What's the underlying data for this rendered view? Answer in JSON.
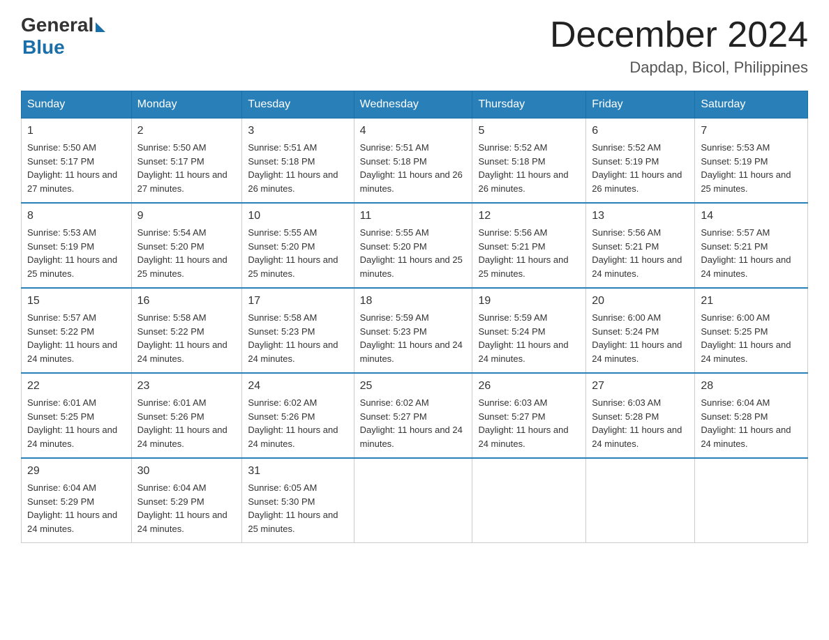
{
  "logo": {
    "general": "General",
    "blue": "Blue"
  },
  "title": "December 2024",
  "subtitle": "Dapdap, Bicol, Philippines",
  "days": [
    "Sunday",
    "Monday",
    "Tuesday",
    "Wednesday",
    "Thursday",
    "Friday",
    "Saturday"
  ],
  "weeks": [
    [
      {
        "day": "1",
        "sunrise": "5:50 AM",
        "sunset": "5:17 PM",
        "daylight": "11 hours and 27 minutes."
      },
      {
        "day": "2",
        "sunrise": "5:50 AM",
        "sunset": "5:17 PM",
        "daylight": "11 hours and 27 minutes."
      },
      {
        "day": "3",
        "sunrise": "5:51 AM",
        "sunset": "5:18 PM",
        "daylight": "11 hours and 26 minutes."
      },
      {
        "day": "4",
        "sunrise": "5:51 AM",
        "sunset": "5:18 PM",
        "daylight": "11 hours and 26 minutes."
      },
      {
        "day": "5",
        "sunrise": "5:52 AM",
        "sunset": "5:18 PM",
        "daylight": "11 hours and 26 minutes."
      },
      {
        "day": "6",
        "sunrise": "5:52 AM",
        "sunset": "5:19 PM",
        "daylight": "11 hours and 26 minutes."
      },
      {
        "day": "7",
        "sunrise": "5:53 AM",
        "sunset": "5:19 PM",
        "daylight": "11 hours and 25 minutes."
      }
    ],
    [
      {
        "day": "8",
        "sunrise": "5:53 AM",
        "sunset": "5:19 PM",
        "daylight": "11 hours and 25 minutes."
      },
      {
        "day": "9",
        "sunrise": "5:54 AM",
        "sunset": "5:20 PM",
        "daylight": "11 hours and 25 minutes."
      },
      {
        "day": "10",
        "sunrise": "5:55 AM",
        "sunset": "5:20 PM",
        "daylight": "11 hours and 25 minutes."
      },
      {
        "day": "11",
        "sunrise": "5:55 AM",
        "sunset": "5:20 PM",
        "daylight": "11 hours and 25 minutes."
      },
      {
        "day": "12",
        "sunrise": "5:56 AM",
        "sunset": "5:21 PM",
        "daylight": "11 hours and 25 minutes."
      },
      {
        "day": "13",
        "sunrise": "5:56 AM",
        "sunset": "5:21 PM",
        "daylight": "11 hours and 24 minutes."
      },
      {
        "day": "14",
        "sunrise": "5:57 AM",
        "sunset": "5:21 PM",
        "daylight": "11 hours and 24 minutes."
      }
    ],
    [
      {
        "day": "15",
        "sunrise": "5:57 AM",
        "sunset": "5:22 PM",
        "daylight": "11 hours and 24 minutes."
      },
      {
        "day": "16",
        "sunrise": "5:58 AM",
        "sunset": "5:22 PM",
        "daylight": "11 hours and 24 minutes."
      },
      {
        "day": "17",
        "sunrise": "5:58 AM",
        "sunset": "5:23 PM",
        "daylight": "11 hours and 24 minutes."
      },
      {
        "day": "18",
        "sunrise": "5:59 AM",
        "sunset": "5:23 PM",
        "daylight": "11 hours and 24 minutes."
      },
      {
        "day": "19",
        "sunrise": "5:59 AM",
        "sunset": "5:24 PM",
        "daylight": "11 hours and 24 minutes."
      },
      {
        "day": "20",
        "sunrise": "6:00 AM",
        "sunset": "5:24 PM",
        "daylight": "11 hours and 24 minutes."
      },
      {
        "day": "21",
        "sunrise": "6:00 AM",
        "sunset": "5:25 PM",
        "daylight": "11 hours and 24 minutes."
      }
    ],
    [
      {
        "day": "22",
        "sunrise": "6:01 AM",
        "sunset": "5:25 PM",
        "daylight": "11 hours and 24 minutes."
      },
      {
        "day": "23",
        "sunrise": "6:01 AM",
        "sunset": "5:26 PM",
        "daylight": "11 hours and 24 minutes."
      },
      {
        "day": "24",
        "sunrise": "6:02 AM",
        "sunset": "5:26 PM",
        "daylight": "11 hours and 24 minutes."
      },
      {
        "day": "25",
        "sunrise": "6:02 AM",
        "sunset": "5:27 PM",
        "daylight": "11 hours and 24 minutes."
      },
      {
        "day": "26",
        "sunrise": "6:03 AM",
        "sunset": "5:27 PM",
        "daylight": "11 hours and 24 minutes."
      },
      {
        "day": "27",
        "sunrise": "6:03 AM",
        "sunset": "5:28 PM",
        "daylight": "11 hours and 24 minutes."
      },
      {
        "day": "28",
        "sunrise": "6:04 AM",
        "sunset": "5:28 PM",
        "daylight": "11 hours and 24 minutes."
      }
    ],
    [
      {
        "day": "29",
        "sunrise": "6:04 AM",
        "sunset": "5:29 PM",
        "daylight": "11 hours and 24 minutes."
      },
      {
        "day": "30",
        "sunrise": "6:04 AM",
        "sunset": "5:29 PM",
        "daylight": "11 hours and 24 minutes."
      },
      {
        "day": "31",
        "sunrise": "6:05 AM",
        "sunset": "5:30 PM",
        "daylight": "11 hours and 25 minutes."
      },
      null,
      null,
      null,
      null
    ]
  ],
  "labels": {
    "sunrise": "Sunrise:",
    "sunset": "Sunset:",
    "daylight": "Daylight:"
  }
}
